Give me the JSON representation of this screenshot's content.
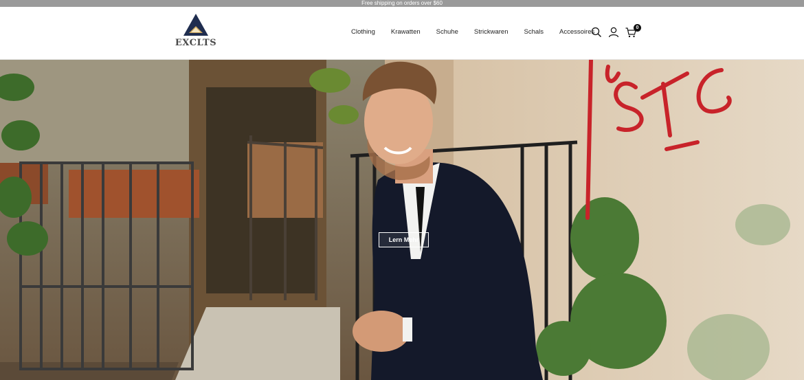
{
  "announcement": "Free shipping on orders over $60",
  "brand": {
    "name": "EXCLTS",
    "logo_color": "#1f2d4f",
    "logo_accent": "#c9a35a"
  },
  "nav": {
    "items": [
      {
        "label": "Clothing"
      },
      {
        "label": "Krawatten"
      },
      {
        "label": "Schuhe"
      },
      {
        "label": "Strickwaren"
      },
      {
        "label": "Schals"
      },
      {
        "label": "Accessoires"
      }
    ]
  },
  "header_icons": {
    "search": "search-icon",
    "account": "user-icon",
    "cart": "cart-icon",
    "cart_count": "0"
  },
  "hero": {
    "cta_label": "Lern Mehr",
    "graffiti_color": "#c8232a"
  }
}
